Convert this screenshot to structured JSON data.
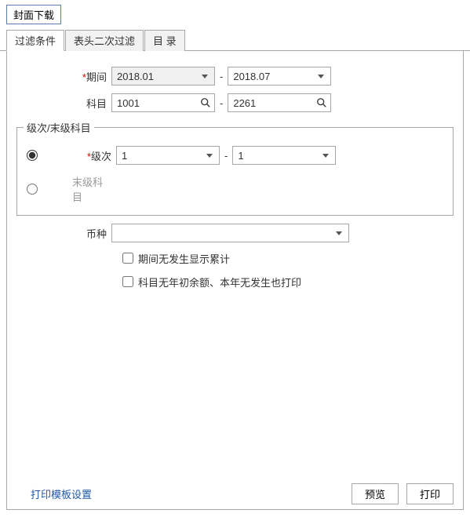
{
  "top_button": "封面下载",
  "tabs": {
    "filter": "过滤条件",
    "header_filter": "表头二次过滤",
    "contents": "目 录"
  },
  "period": {
    "label": "期间",
    "from": "2018.01",
    "to": "2018.07"
  },
  "subject": {
    "label": "科目",
    "from": "1001",
    "to": "2261"
  },
  "level_group": {
    "legend": "级次/末级科目",
    "level_label": "级次",
    "level_from": "1",
    "level_to": "1",
    "leaf_label": "末级科目"
  },
  "currency": {
    "label": "币种",
    "value": ""
  },
  "checks": {
    "no_occur_show_total": "期间无发生显示累计",
    "no_balance_print": "科目无年初余额、本年无发生也打印"
  },
  "footer": {
    "template_link": "打印模板设置",
    "preview": "预览",
    "print": "打印"
  },
  "separator": "-"
}
